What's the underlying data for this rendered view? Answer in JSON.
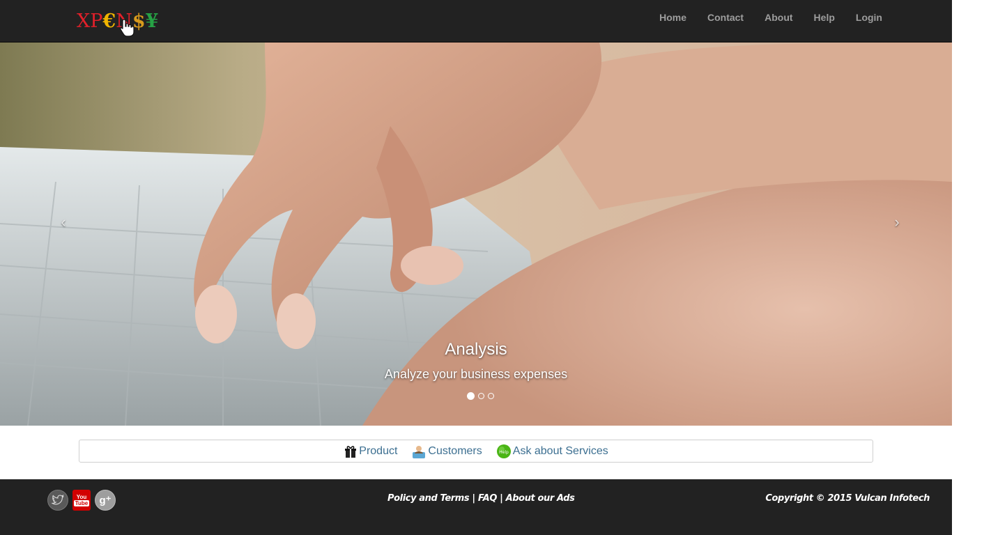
{
  "brand": {
    "logo_text": [
      "X",
      "P",
      "€",
      "N",
      "$",
      "¥"
    ],
    "colors": {
      "red": "#e3202a",
      "gold": "#f0b400",
      "orange": "#d89a1c",
      "green": "#26a245"
    }
  },
  "nav": {
    "items": [
      {
        "label": "Home"
      },
      {
        "label": "Contact"
      },
      {
        "label": "About"
      },
      {
        "label": "Help"
      },
      {
        "label": "Login"
      }
    ]
  },
  "carousel": {
    "prev": "‹",
    "next": "›",
    "caption_title": "Analysis",
    "caption_text": "Analyze your business expenses",
    "slide_count": 3,
    "active_index": 0
  },
  "panel": {
    "links": [
      {
        "label": "Product",
        "icon": "gift-icon"
      },
      {
        "label": "Customers",
        "icon": "customer-icon"
      },
      {
        "label": "Ask about Services",
        "icon": "help-bubble-icon"
      }
    ]
  },
  "footer": {
    "social": [
      {
        "name": "twitter-icon"
      },
      {
        "name": "youtube-icon",
        "top": "You",
        "bottom": "Tube"
      },
      {
        "name": "google-plus-icon",
        "glyph": "g⁺"
      }
    ],
    "links": [
      "Policy and Terms",
      "FAQ",
      "About our Ads"
    ],
    "separator": " | ",
    "copyright": "Copyright © 2015 Vulcan Infotech"
  },
  "colors": {
    "navbar_bg": "#222222",
    "nav_text": "#9d9d9d",
    "link_blue": "#3c6f91",
    "footer_bg": "#222222"
  }
}
